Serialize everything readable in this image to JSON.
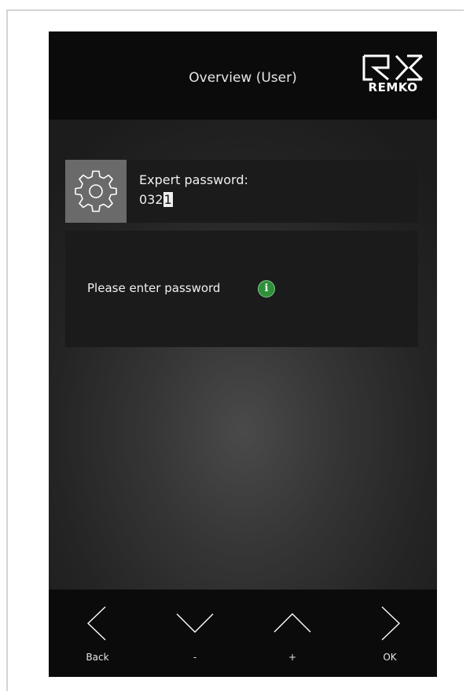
{
  "header": {
    "title": "Overview (User)",
    "logo_text": "REMKO"
  },
  "password": {
    "label": "Expert password:",
    "value_prefix": "032",
    "value_cursor": "1",
    "icon": "gear-icon"
  },
  "message": {
    "text": "Please enter password",
    "info_icon_glyph": "i",
    "info_color": "#2f8f3a"
  },
  "footer": {
    "back_label": "Back",
    "minus_label": "-",
    "plus_label": "+",
    "ok_label": "OK"
  }
}
